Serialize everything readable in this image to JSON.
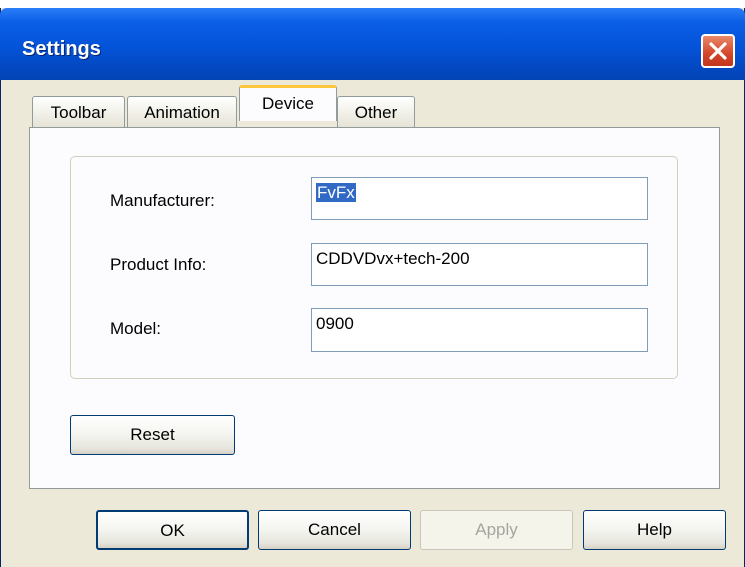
{
  "window": {
    "title": "Settings"
  },
  "tabs": [
    {
      "label": "Toolbar"
    },
    {
      "label": "Animation"
    },
    {
      "label": "Device",
      "active": true
    },
    {
      "label": "Other"
    }
  ],
  "device": {
    "manufacturer_label": "Manufacturer:",
    "manufacturer_value": "FvFx",
    "product_info_label": "Product Info:",
    "product_info_value": "CDDVDvx+tech-200",
    "model_label": "Model:",
    "model_value": "0900"
  },
  "reset_label": "Reset",
  "footer": {
    "ok_label": "OK",
    "cancel_label": "Cancel",
    "apply_label": "Apply",
    "help_label": "Help"
  },
  "colors": {
    "titlebar": "#0453d9",
    "close_button": "#d4452a",
    "active_tab_highlight": "#ffc83c",
    "selection": "#316ac5"
  }
}
